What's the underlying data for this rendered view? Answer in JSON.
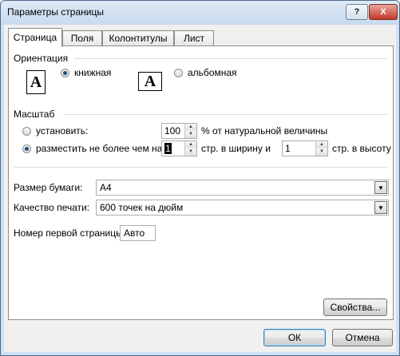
{
  "window": {
    "title": "Параметры страницы",
    "help_label": "?",
    "close_label": "X"
  },
  "tabs": [
    {
      "label": "Страница",
      "active": true
    },
    {
      "label": "Поля",
      "active": false
    },
    {
      "label": "Колонтитулы",
      "active": false
    },
    {
      "label": "Лист",
      "active": false
    }
  ],
  "orientation": {
    "group_label": "Ориентация",
    "icon_glyph": "A",
    "portrait_label": "книжная",
    "landscape_label": "альбомная",
    "selected": "portrait"
  },
  "scaling": {
    "group_label": "Масштаб",
    "adjust_label": "установить:",
    "adjust_value": "100",
    "adjust_suffix": "% от натуральной величины",
    "fit_label": "разместить не более чем на:",
    "fit_wide_value": "1",
    "fit_wide_suffix": "стр. в ширину и",
    "fit_tall_value": "1",
    "fit_tall_suffix": "стр. в высоту",
    "selected": "fit"
  },
  "paper": {
    "size_label": "Размер бумаги:",
    "size_value": "A4",
    "quality_label": "Качество печати:",
    "quality_value": "600 точек на дюйм",
    "first_page_label": "Номер первой страницы:",
    "first_page_value": "Авто"
  },
  "buttons": {
    "options_label": "Свойства...",
    "ok_label": "ОК",
    "cancel_label": "Отмена"
  },
  "icons": {
    "radio_icon": "radio-button",
    "spin_up_icon": "▲",
    "spin_down_icon": "▼",
    "dropdown_icon": "▼"
  }
}
